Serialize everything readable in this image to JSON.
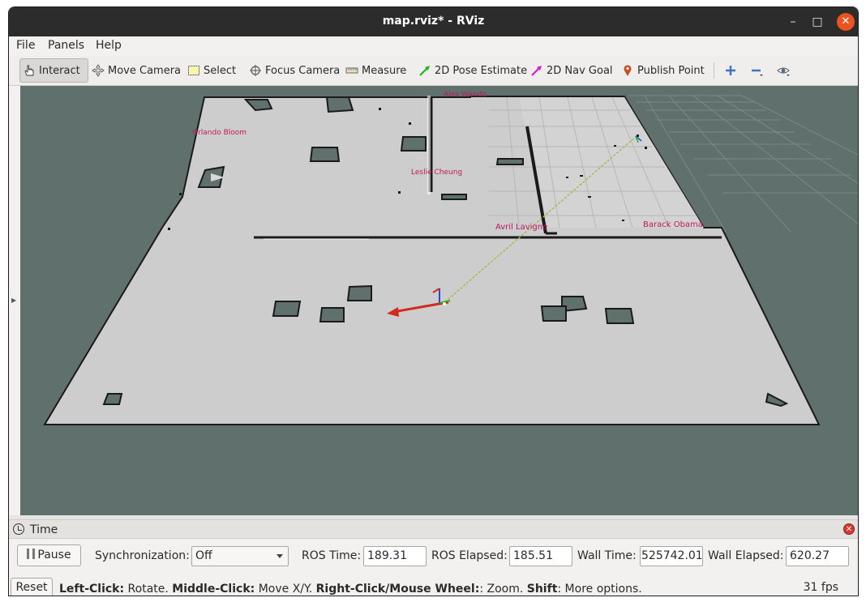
{
  "window": {
    "title": "map.rviz* - RViz"
  },
  "menu": {
    "file": "File",
    "panels": "Panels",
    "help": "Help"
  },
  "toolbar": {
    "interact": "Interact",
    "move_camera": "Move Camera",
    "select": "Select",
    "focus_camera": "Focus Camera",
    "measure": "Measure",
    "pose_estimate": "2D Pose Estimate",
    "nav_goal": "2D Nav Goal",
    "publish_point": "Publish Point"
  },
  "map_labels": {
    "top": "Alex Wanda",
    "orlando": "Orlando Bloom",
    "leslie": "Leslie  Cheung",
    "avril": "Avril  Lavigne",
    "barack": "Barack  Obama"
  },
  "time_panel": {
    "title": "Time",
    "pause": "Pause",
    "sync_label": "Synchronization:",
    "sync_value": "Off",
    "ros_time_label": "ROS Time:",
    "ros_time": "189.31",
    "ros_elapsed_label": "ROS Elapsed:",
    "ros_elapsed": "185.51",
    "wall_time_label": "Wall Time:",
    "wall_time": "525742.01",
    "wall_elapsed_label": "Wall Elapsed:",
    "wall_elapsed": "620.27"
  },
  "status": {
    "reset": "Reset",
    "left_click": "Left-Click:",
    "left_click_desc": " Rotate. ",
    "middle_click": "Middle-Click:",
    "middle_click_desc": " Move X/Y. ",
    "right_click": "Right-Click/Mouse Wheel:",
    "right_click_desc": ": Zoom. ",
    "shift": "Shift",
    "shift_desc": ": More options.",
    "fps": "31 fps"
  },
  "colors": {
    "viewport_bg": "#5f706d",
    "map_floor": "#cdcdcd",
    "label_color": "#c0185a",
    "accent": "#e95420"
  }
}
